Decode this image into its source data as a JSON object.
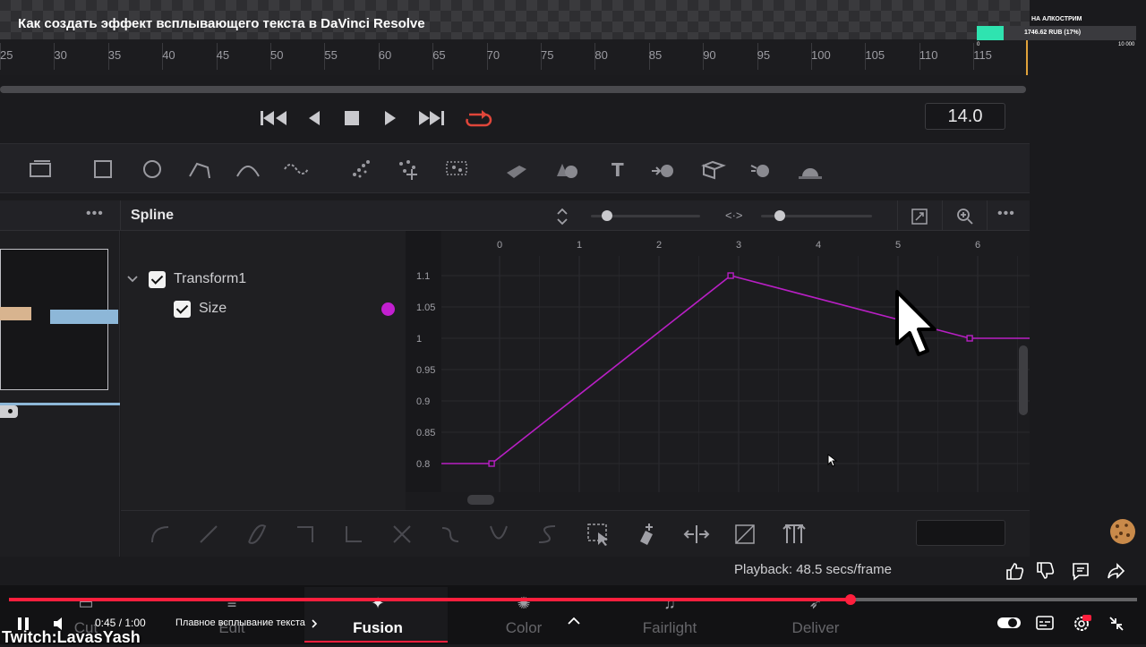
{
  "video": {
    "title": "Как создать эффект всплывающего текста в DaVinci Resolve",
    "chapter": "Плавное всплывание текста",
    "time": "0:45 / 1:00",
    "progress_fraction": 0.746,
    "watermark": "Twitch:LavasYash"
  },
  "donation": {
    "label": "НА АЛКОСТРИМ",
    "amount": "1746.62 RUB (17%)",
    "min": "0",
    "max": "10 000",
    "fraction": 0.17
  },
  "ruler": {
    "ticks": [
      "25",
      "30",
      "35",
      "40",
      "45",
      "50",
      "55",
      "60",
      "65",
      "70",
      "75",
      "80",
      "85",
      "90",
      "95",
      "100",
      "105",
      "110",
      "115"
    ]
  },
  "transport": {
    "frame": "14.0"
  },
  "panel": {
    "title": "Spline"
  },
  "tree": {
    "node": "Transform1",
    "param": "Size"
  },
  "status": {
    "playback": "Playback: 48.5 secs/frame"
  },
  "pages": [
    "Cut",
    "Edit",
    "Fusion",
    "Color",
    "Fairlight",
    "Deliver"
  ],
  "active_page": "Fusion",
  "spline_graph": {
    "x_ticks": [
      "0",
      "1",
      "2",
      "3",
      "4",
      "5",
      "6"
    ],
    "y_ticks": [
      "1.1",
      "1.05",
      "1",
      "0.95",
      "0.9",
      "0.85",
      "0.8"
    ],
    "keyframes": [
      {
        "x": -0.1,
        "y": 0.8
      },
      {
        "x": 2.9,
        "y": 1.1
      },
      {
        "x": 5.9,
        "y": 1.0
      }
    ],
    "curve_color": "#b81fc4"
  },
  "colors": {
    "accent_red": "#ff1f3d",
    "playhead": "#e0a23a",
    "loop_icon": "#e0463a",
    "donation_bar": "#2fe3b0"
  }
}
